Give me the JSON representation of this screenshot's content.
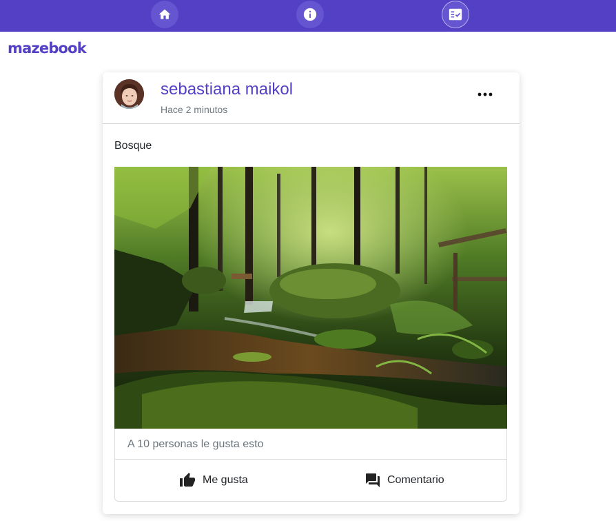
{
  "nav": {
    "items": [
      {
        "icon": "home-icon"
      },
      {
        "icon": "info-icon"
      },
      {
        "icon": "tasks-icon"
      }
    ]
  },
  "brand": {
    "name": "mazebook"
  },
  "post": {
    "author": "sebastiana maikol",
    "time": "Hace 2 minutos",
    "text": "Bosque",
    "image_subject": "forest-stream-photo",
    "likes_text": "A 10 personas le gusta esto",
    "like_label": "Me gusta",
    "comment_label": "Comentario"
  },
  "colors": {
    "primary": "#5340c4",
    "muted": "#6c757d"
  }
}
